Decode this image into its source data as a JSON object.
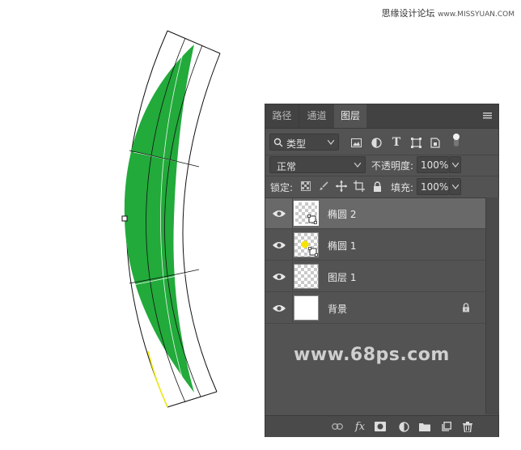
{
  "watermark": {
    "text": "思缘设计论坛",
    "url": "www.MISSYUAN.COM"
  },
  "canvas": {
    "shape_color": "#22aa3b",
    "path_highlight": "#f0e800"
  },
  "panel": {
    "tabs": [
      {
        "label": "路径"
      },
      {
        "label": "通道"
      },
      {
        "label": "图层",
        "active": true
      }
    ],
    "filter": {
      "kind": "类型"
    },
    "blend": {
      "mode": "正常",
      "opacity_label": "不透明度:",
      "opacity": "100%"
    },
    "lock": {
      "label": "锁定:",
      "fill_label": "填充:",
      "fill": "100%"
    },
    "layers": [
      {
        "name": "椭圆 2",
        "selected": true,
        "visible": true
      },
      {
        "name": "椭圆 1",
        "selected": false,
        "visible": true
      },
      {
        "name": "图层 1",
        "selected": false,
        "visible": true
      },
      {
        "name": "背景",
        "selected": false,
        "visible": true,
        "locked": true
      }
    ],
    "site_watermark": "www.68ps.com"
  },
  "icons": {
    "menu": "menu-icon",
    "search": "search-icon",
    "eye": "eye-icon",
    "lock": "lock-icon",
    "bottom": [
      "link-icon",
      "fx-icon",
      "mask-icon",
      "adjustment-icon",
      "folder-icon",
      "new-layer-icon",
      "trash-icon"
    ]
  }
}
